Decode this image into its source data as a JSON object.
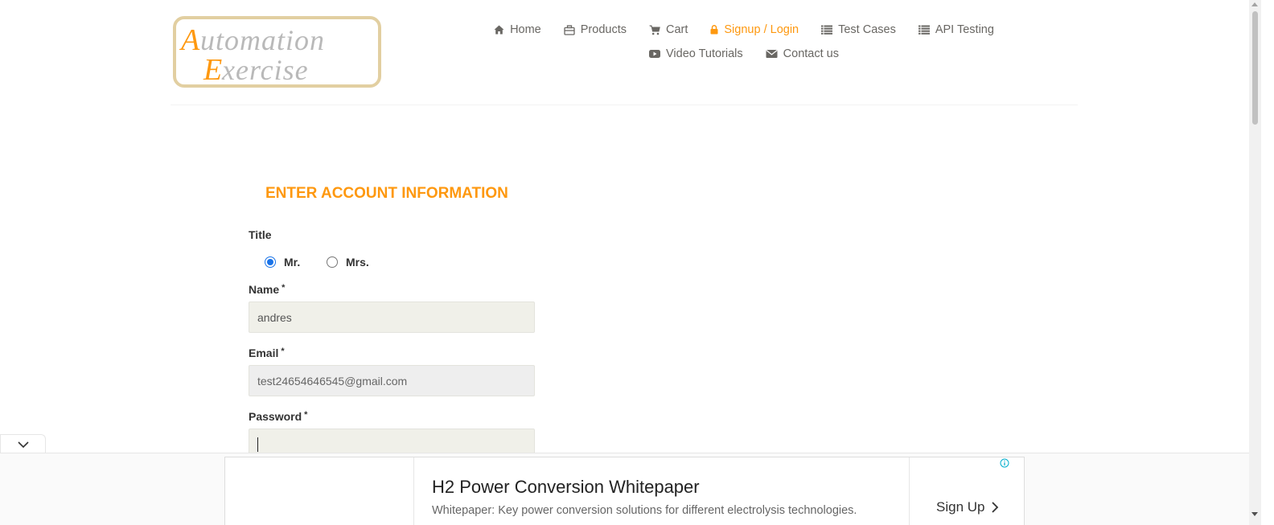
{
  "logo": {
    "line1": "Automation",
    "line2": "Exercise",
    "icon": "automation-exercise-logo"
  },
  "nav": {
    "row1": [
      {
        "label": "Home",
        "icon": "home-icon"
      },
      {
        "label": "Products",
        "icon": "products-icon"
      },
      {
        "label": "Cart",
        "icon": "cart-icon"
      },
      {
        "label": "Signup / Login",
        "icon": "lock-icon",
        "active": true
      },
      {
        "label": "Test Cases",
        "icon": "list-icon"
      },
      {
        "label": "API Testing",
        "icon": "list-icon"
      }
    ],
    "row2": [
      {
        "label": "Video Tutorials",
        "icon": "youtube-icon"
      },
      {
        "label": "Contact us",
        "icon": "envelope-icon"
      }
    ]
  },
  "form": {
    "title": "ENTER ACCOUNT INFORMATION",
    "title_label": "Title",
    "radio_mr": "Mr.",
    "radio_mrs": "Mrs.",
    "selected_title": "Mr.",
    "name_label": "Name",
    "name_value": "andres",
    "email_label": "Email",
    "email_value": "test24654646545@gmail.com",
    "password_label": "Password",
    "password_value": "",
    "required_mark": "*"
  },
  "ad": {
    "headline": "H2 Power Conversion Whitepaper",
    "description": "Whitepaper: Key power conversion solutions for different electrolysis technologies.",
    "cta": "Sign Up",
    "info_icon": "info-icon"
  },
  "colors": {
    "accent": "#fe980f",
    "nav_text": "#696763",
    "field_bg": "#f0f0e9"
  }
}
